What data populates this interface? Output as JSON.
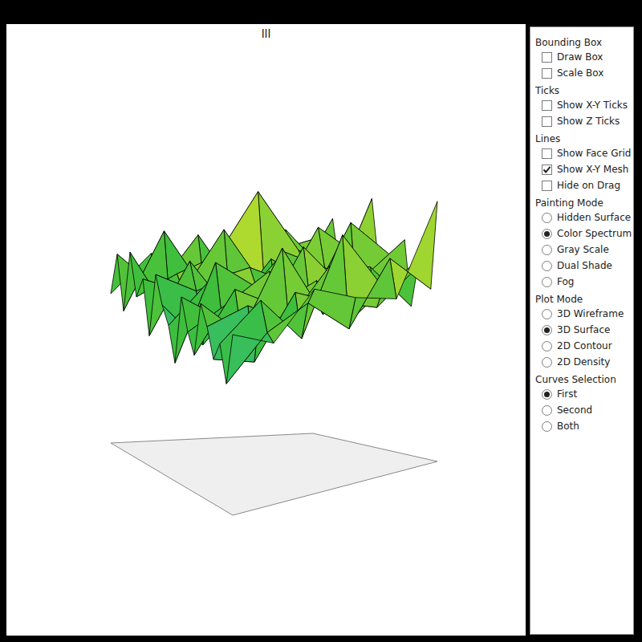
{
  "plot": {
    "title": "lll",
    "surface": {
      "values": [
        [
          0.55,
          0.62,
          0.48,
          0.71,
          0.52,
          0.44,
          0.66,
          0.58,
          0.49,
          0.83,
          0.57,
          0.46,
          0.61,
          0.53,
          0.69,
          0.42,
          0.59,
          0.64,
          0.51,
          0.88
        ],
        [
          0.47,
          0.58,
          0.67,
          0.43,
          0.6,
          0.54,
          0.49,
          0.72,
          0.56,
          0.45,
          0.63,
          0.5,
          0.78,
          0.41,
          0.57,
          0.62,
          0.46,
          0.55,
          0.68,
          0.52
        ],
        [
          0.63,
          0.41,
          0.56,
          0.59,
          0.86,
          0.47,
          0.6,
          0.44,
          0.65,
          0.53,
          0.39,
          0.7,
          0.48,
          0.58,
          0.45,
          0.66,
          0.52,
          0.81,
          0.43,
          0.57
        ],
        [
          0.5,
          0.66,
          0.44,
          0.52,
          0.61,
          0.73,
          0.4,
          0.57,
          0.48,
          0.62,
          0.55,
          0.43,
          0.64,
          0.51,
          0.76,
          0.47,
          0.6,
          0.42,
          0.58,
          0.65
        ],
        [
          0.58,
          0.45,
          0.7,
          0.36,
          0.55,
          0.49,
          0.63,
          0.52,
          0.31,
          0.59,
          0.68,
          0.46,
          0.54,
          0.61,
          0.44,
          0.57,
          0.35,
          0.62,
          0.5,
          0.47
        ],
        [
          0.42,
          0.6,
          0.38,
          0.64,
          0.47,
          0.56,
          0.34,
          0.61,
          0.5,
          0.43,
          0.29,
          0.58,
          0.45,
          0.37,
          0.6,
          0.52,
          0.4,
          0.48,
          0.33,
          0.55
        ]
      ]
    }
  },
  "panel": {
    "sections": [
      {
        "title": "Bounding Box",
        "items": [
          {
            "label": "Draw Box",
            "kind": "checkbox",
            "checked": false
          },
          {
            "label": "Scale Box",
            "kind": "checkbox",
            "checked": false
          }
        ]
      },
      {
        "title": "Ticks",
        "items": [
          {
            "label": "Show X-Y Ticks",
            "kind": "checkbox",
            "checked": false
          },
          {
            "label": "Show Z Ticks",
            "kind": "checkbox",
            "checked": false
          }
        ]
      },
      {
        "title": "Lines",
        "items": [
          {
            "label": "Show Face Grid",
            "kind": "checkbox",
            "checked": false
          },
          {
            "label": "Show X-Y Mesh",
            "kind": "checkbox",
            "checked": true
          },
          {
            "label": "Hide on Drag",
            "kind": "checkbox",
            "checked": false
          }
        ]
      },
      {
        "title": "Painting Mode",
        "items": [
          {
            "label": "Hidden Surface",
            "kind": "radio",
            "selected": false
          },
          {
            "label": "Color Spectrum",
            "kind": "radio",
            "selected": true
          },
          {
            "label": "Gray Scale",
            "kind": "radio",
            "selected": false
          },
          {
            "label": "Dual Shade",
            "kind": "radio",
            "selected": false
          },
          {
            "label": "Fog",
            "kind": "radio",
            "selected": false
          }
        ]
      },
      {
        "title": "Plot Mode",
        "items": [
          {
            "label": "3D Wireframe",
            "kind": "radio",
            "selected": false
          },
          {
            "label": "3D Surface",
            "kind": "radio",
            "selected": true
          },
          {
            "label": "2D Contour",
            "kind": "radio",
            "selected": false
          },
          {
            "label": "2D Density",
            "kind": "radio",
            "selected": false
          }
        ]
      },
      {
        "title": "Curves Selection",
        "items": [
          {
            "label": "First",
            "kind": "radio",
            "selected": true
          },
          {
            "label": "Second",
            "kind": "radio",
            "selected": false
          },
          {
            "label": "Both",
            "kind": "radio",
            "selected": false
          }
        ]
      }
    ]
  }
}
